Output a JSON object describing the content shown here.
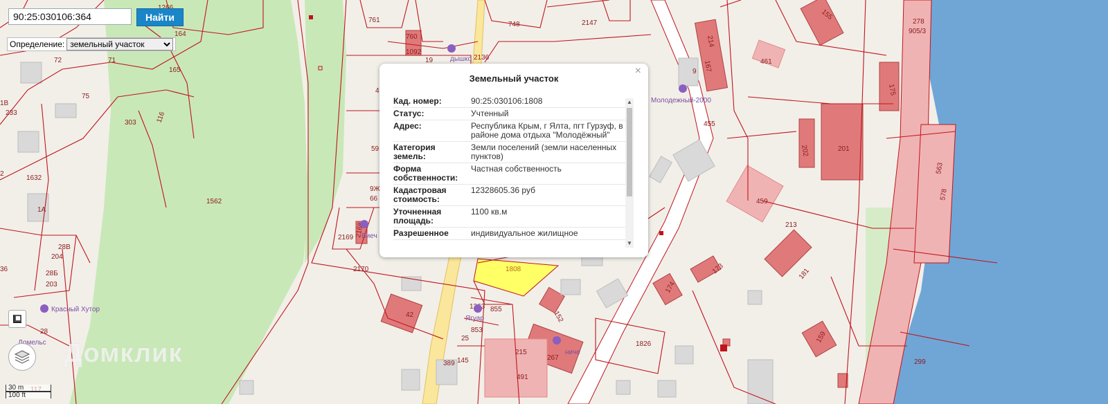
{
  "search": {
    "value": "90:25:030106:364",
    "button_label": "Найти"
  },
  "definition": {
    "label": "Определение:",
    "selected": "земельный участок"
  },
  "popup": {
    "title": "Земельный участок",
    "close_glyph": "×",
    "rows": [
      {
        "key": "Кад. номер:",
        "value": "90:25:030106:1808"
      },
      {
        "key": "Статус:",
        "value": "Учтенный"
      },
      {
        "key": "Адрес:",
        "value": "Республика Крым, г Ялта, пгт Гурзуф, в районе дома отдыха \"Молодёжный\""
      },
      {
        "key": "Категория земель:",
        "value": "Земли поселений (земли населенных пунктов)"
      },
      {
        "key": "Форма собственности:",
        "value": "Частная собственность"
      },
      {
        "key": "Кадастровая стоимость:",
        "value": "12328605.36 руб"
      },
      {
        "key": "Уточненная площадь:",
        "value": "1100 кв.м"
      },
      {
        "key": "Разрешенное",
        "value": "индивидуальное жилищное"
      }
    ]
  },
  "map": {
    "parcel_labels": [
      "1266",
      "164",
      "165",
      "72",
      "71",
      "75",
      "1В",
      "233",
      "303",
      "116",
      "1632",
      "1А",
      "1562",
      "2",
      "36",
      "28В",
      "204",
      "28Б",
      "203",
      "28",
      "117",
      "761",
      "760",
      "1092",
      "19",
      "748",
      "2147",
      "2136",
      "214",
      "155",
      "278",
      "905/3",
      "9",
      "461",
      "175",
      "4",
      "1",
      "455",
      "59",
      "9Ж",
      "66",
      "2169",
      "2168",
      "2170",
      "1808",
      "202",
      "201",
      "563",
      "578",
      "459",
      "213",
      "173",
      "181",
      "174",
      "152",
      "1263",
      "855",
      "853",
      "25",
      "389",
      "145",
      "215",
      "267",
      "491",
      "1826",
      "159",
      "299"
    ],
    "poi_labels": [
      "Красный Хутор",
      "Молодежный-2000",
      "Ягуар",
      "Домельс",
      "дышко",
      "Виеч",
      "ниче"
    ],
    "highlight_color": "#ffff66",
    "parcel_line_color": "#c0141b",
    "building_color": "#e07a7a",
    "water_color": "#6fa6d6"
  },
  "scale": {
    "metric": "30 m",
    "imperial": "100 ft"
  },
  "watermark": "Домклик",
  "tools": {
    "draw_icon": "square-icon",
    "layers_icon": "layers-icon"
  }
}
